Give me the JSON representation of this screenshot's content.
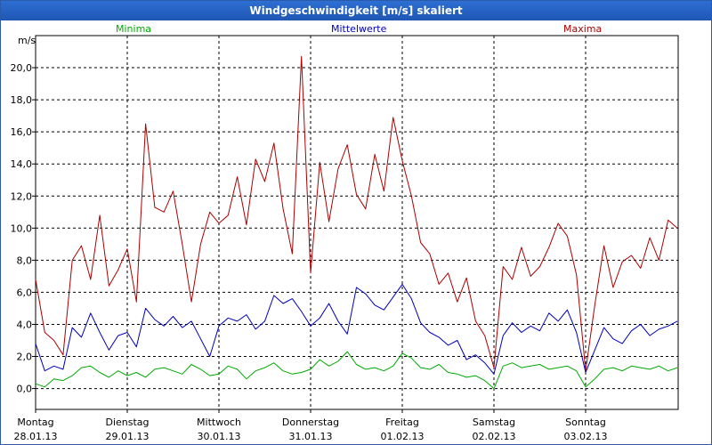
{
  "window": {
    "title": "Windgeschwindigkeit [m/s] skaliert"
  },
  "legend": {
    "minima": "Minima",
    "mittelwerte": "Mittelwerte",
    "maxima": "Maxima"
  },
  "colors": {
    "minima": "#00aa00",
    "mittelwerte": "#0000bb",
    "maxima": "#aa0000",
    "titlebar": "#2563c4",
    "grid": "#000000"
  },
  "chart_data": {
    "type": "line",
    "title": "Windgeschwindigkeit [m/s] skaliert",
    "ylabel": "m/s",
    "ylim": [
      -1.3,
      22.0
    ],
    "yticks": [
      "0,0",
      "2,0",
      "4,0",
      "6,0",
      "8,0",
      "10,0",
      "12,0",
      "14,0",
      "16,0",
      "18,0",
      "20,0"
    ],
    "xlim": [
      0,
      7.0
    ],
    "xticks": [
      {
        "day": "Montag",
        "date": "28.01.13"
      },
      {
        "day": "Dienstag",
        "date": "29.01.13"
      },
      {
        "day": "Mittwoch",
        "date": "30.01.13"
      },
      {
        "day": "Donnerstag",
        "date": "31.01.13"
      },
      {
        "day": "Freitag",
        "date": "01.02.13"
      },
      {
        "day": "Samstag",
        "date": "02.02.13"
      },
      {
        "day": "Sonntag",
        "date": "03.02.13"
      }
    ],
    "grid": true,
    "legend_position": "top",
    "series": [
      {
        "name": "Minima",
        "color": "#00aa00",
        "x": [
          0.0,
          0.1,
          0.2,
          0.3,
          0.4,
          0.5,
          0.6,
          0.7,
          0.8,
          0.9,
          1.0,
          1.1,
          1.2,
          1.3,
          1.4,
          1.5,
          1.6,
          1.7,
          1.8,
          1.9,
          2.0,
          2.1,
          2.2,
          2.3,
          2.4,
          2.5,
          2.6,
          2.7,
          2.8,
          2.9,
          3.0,
          3.1,
          3.2,
          3.3,
          3.4,
          3.5,
          3.6,
          3.7,
          3.8,
          3.9,
          4.0,
          4.1,
          4.2,
          4.3,
          4.4,
          4.5,
          4.6,
          4.7,
          4.8,
          4.9,
          5.0,
          5.1,
          5.2,
          5.3,
          5.4,
          5.5,
          5.6,
          5.7,
          5.8,
          5.9,
          6.0,
          6.1,
          6.2,
          6.3,
          6.4,
          6.5,
          6.6,
          6.7,
          6.8,
          6.9,
          7.0
        ],
        "y": [
          0.3,
          0.1,
          0.6,
          0.5,
          0.8,
          1.3,
          1.4,
          1.0,
          0.7,
          1.1,
          0.8,
          1.0,
          0.7,
          1.2,
          1.3,
          1.1,
          0.9,
          1.5,
          1.2,
          0.8,
          0.9,
          1.4,
          1.2,
          0.6,
          1.1,
          1.3,
          1.6,
          1.1,
          0.9,
          1.0,
          1.2,
          1.8,
          1.4,
          1.7,
          2.3,
          1.5,
          1.2,
          1.3,
          1.1,
          1.4,
          2.2,
          1.9,
          1.3,
          1.2,
          1.5,
          1.0,
          0.9,
          0.7,
          0.8,
          0.5,
          0.0,
          1.4,
          1.6,
          1.3,
          1.4,
          1.5,
          1.2,
          1.3,
          1.4,
          1.1,
          0.1,
          0.6,
          1.2,
          1.3,
          1.1,
          1.4,
          1.3,
          1.2,
          1.4,
          1.1,
          1.3
        ]
      },
      {
        "name": "Mittelwerte",
        "color": "#0000bb",
        "x": [
          0.0,
          0.1,
          0.2,
          0.3,
          0.4,
          0.5,
          0.6,
          0.7,
          0.8,
          0.9,
          1.0,
          1.1,
          1.2,
          1.3,
          1.4,
          1.5,
          1.6,
          1.7,
          1.8,
          1.9,
          2.0,
          2.1,
          2.2,
          2.3,
          2.4,
          2.5,
          2.6,
          2.7,
          2.8,
          2.9,
          3.0,
          3.1,
          3.2,
          3.3,
          3.4,
          3.5,
          3.6,
          3.7,
          3.8,
          3.9,
          4.0,
          4.1,
          4.2,
          4.3,
          4.4,
          4.5,
          4.6,
          4.7,
          4.8,
          4.9,
          5.0,
          5.1,
          5.2,
          5.3,
          5.4,
          5.5,
          5.6,
          5.7,
          5.8,
          5.9,
          6.0,
          6.1,
          6.2,
          6.3,
          6.4,
          6.5,
          6.6,
          6.7,
          6.8,
          6.9,
          7.0
        ],
        "y": [
          2.8,
          1.1,
          1.4,
          1.2,
          3.8,
          3.2,
          4.7,
          3.5,
          2.4,
          3.3,
          3.5,
          2.6,
          5.0,
          4.3,
          3.9,
          4.5,
          3.8,
          4.2,
          3.1,
          2.0,
          3.9,
          4.4,
          4.2,
          4.6,
          3.7,
          4.2,
          5.8,
          5.3,
          5.6,
          4.8,
          3.9,
          4.4,
          5.3,
          4.2,
          3.4,
          6.3,
          5.9,
          5.2,
          4.9,
          5.7,
          6.5,
          5.6,
          4.1,
          3.5,
          3.2,
          2.7,
          3.0,
          1.8,
          2.1,
          1.6,
          0.9,
          3.3,
          4.1,
          3.5,
          3.9,
          3.6,
          4.7,
          4.2,
          4.9,
          3.5,
          1.0,
          2.4,
          3.8,
          3.1,
          2.8,
          3.6,
          4.0,
          3.3,
          3.7,
          3.9,
          4.2
        ]
      },
      {
        "name": "Maxima",
        "color": "#aa0000",
        "x": [
          0.0,
          0.1,
          0.2,
          0.3,
          0.4,
          0.5,
          0.6,
          0.7,
          0.8,
          0.9,
          1.0,
          1.1,
          1.2,
          1.3,
          1.4,
          1.5,
          1.6,
          1.7,
          1.8,
          1.9,
          2.0,
          2.1,
          2.2,
          2.3,
          2.4,
          2.5,
          2.6,
          2.7,
          2.8,
          2.9,
          3.0,
          3.1,
          3.2,
          3.3,
          3.4,
          3.5,
          3.6,
          3.7,
          3.8,
          3.9,
          4.0,
          4.1,
          4.2,
          4.3,
          4.4,
          4.5,
          4.6,
          4.7,
          4.8,
          4.9,
          5.0,
          5.1,
          5.2,
          5.3,
          5.4,
          5.5,
          5.6,
          5.7,
          5.8,
          5.9,
          6.0,
          6.1,
          6.2,
          6.3,
          6.4,
          6.5,
          6.6,
          6.7,
          6.8,
          6.9,
          7.0
        ],
        "y": [
          6.8,
          3.5,
          3.0,
          2.1,
          8.0,
          8.9,
          6.8,
          10.8,
          6.4,
          7.4,
          8.7,
          5.4,
          16.5,
          11.3,
          11.0,
          12.3,
          9.0,
          5.4,
          9.0,
          11.0,
          10.3,
          10.8,
          13.2,
          10.2,
          14.3,
          12.9,
          15.3,
          11.2,
          8.4,
          20.7,
          7.2,
          14.1,
          10.4,
          13.7,
          15.2,
          12.1,
          11.2,
          14.6,
          12.3,
          16.9,
          14.2,
          12.0,
          9.1,
          8.4,
          6.5,
          7.2,
          5.4,
          6.9,
          4.2,
          3.3,
          1.3,
          7.6,
          6.8,
          8.8,
          7.0,
          7.6,
          8.8,
          10.3,
          9.5,
          7.1,
          1.1,
          5.2,
          8.9,
          6.3,
          7.9,
          8.3,
          7.5,
          9.4,
          8.0,
          10.5,
          10.0
        ]
      }
    ]
  }
}
